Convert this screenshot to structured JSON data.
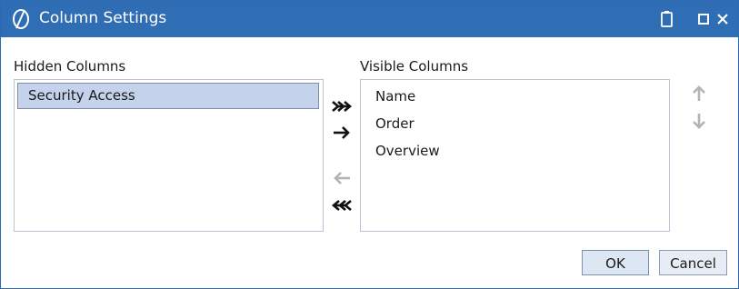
{
  "window": {
    "title": "Column Settings",
    "icons": {
      "app": "app-logo-icon",
      "clipboard": "clipboard-icon",
      "maximize": "maximize-icon",
      "close": "close-icon"
    },
    "colors": {
      "titlebar": "#2f6db5",
      "selection": "#c4d2eb"
    }
  },
  "hidden": {
    "label": "Hidden Columns",
    "items": [
      "Security Access"
    ],
    "selected": "Security Access"
  },
  "visible": {
    "label": "Visible Columns",
    "items": [
      "Name",
      "Order",
      "Overview"
    ]
  },
  "transfer": {
    "move_all_right": "double-arrow-right-icon",
    "move_right": "arrow-right-icon",
    "move_left": "arrow-left-icon",
    "move_all_left": "double-arrow-left-icon"
  },
  "ordering": {
    "up": "arrow-up-icon",
    "down": "arrow-down-icon"
  },
  "buttons": {
    "ok": "OK",
    "cancel": "Cancel"
  }
}
